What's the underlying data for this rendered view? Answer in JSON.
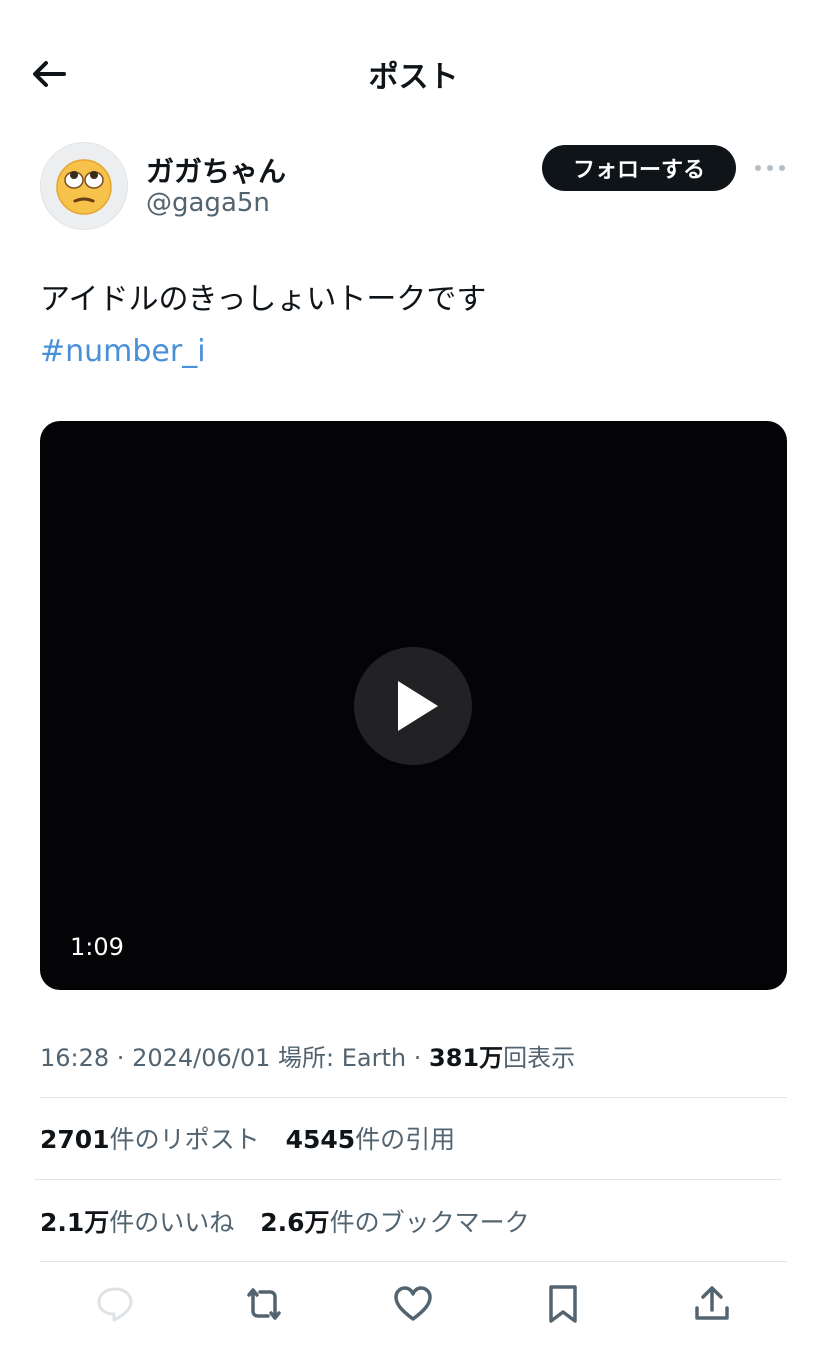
{
  "header": {
    "title": "ポスト",
    "back_icon": "arrow-left-icon"
  },
  "author": {
    "display_name": "ガガちゃん",
    "handle": "@gaga5n",
    "avatar_icon": "eye-roll-emoji-icon"
  },
  "follow_label": "フォローする",
  "more_icon": "more-horizontal-icon",
  "post": {
    "text": "アイドルのきっしょいトークです",
    "hashtag": "#number_i"
  },
  "video": {
    "duration": "1:09",
    "play_icon": "play-icon"
  },
  "meta": {
    "time": "16:28",
    "date": "2024/06/01",
    "location_prefix": "場所: ",
    "location": "Earth",
    "views_value": "381万",
    "views_label": "回表示"
  },
  "stats": {
    "reposts_value": "2701",
    "reposts_label": "件のリポスト",
    "quotes_value": "4545",
    "quotes_label": "件の引用",
    "likes_value": "2.1万",
    "likes_label": "件のいいね",
    "bookmarks_value": "2.6万",
    "bookmarks_label": "件のブックマーク"
  },
  "actions": [
    "reply-icon",
    "repost-icon",
    "like-icon",
    "bookmark-icon",
    "share-icon"
  ],
  "colors": {
    "hashtag": "#4a90d9",
    "follow_bg": "#0f1419",
    "muted": "#536471"
  }
}
